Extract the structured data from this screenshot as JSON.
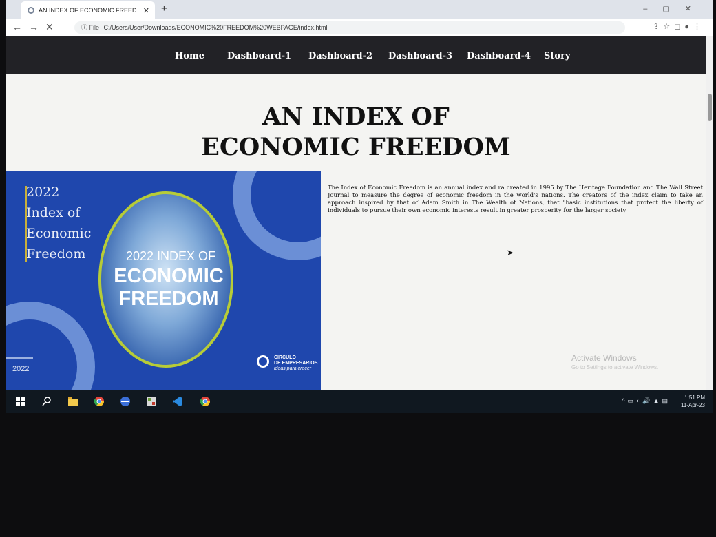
{
  "browser": {
    "tab_title": "AN INDEX OF ECONOMIC FREED",
    "tab_close": "✕",
    "new_tab": "+",
    "back": "←",
    "forward": "→",
    "stop": "✕",
    "file_label": "ⓘ File",
    "url": "C:/Users/User/Downloads/ECONOMIC%20FREEDOM%20WEBPAGE/index.html"
  },
  "nav": {
    "items": [
      "Home",
      "Dashboard-1",
      "Dashboard-2",
      "Dashboard-3",
      "Dashboard-4",
      "Story"
    ]
  },
  "page": {
    "title_line1": "AN INDEX OF",
    "title_line2": "ECONOMIC FREEDOM",
    "description": "The Index of Economic Freedom is an annual index and ra created in 1995 by The Heritage Foundation and The Wall Street Journal to measure the degree of economic freedom in the world's nations. The creators of the index claim to take an approach inspired by that of Adam Smith in The Wealth of Nations, that \"basic institutions that protect the liberty of individuals to pursue their own economic interests result in greater prosperity for the larger society"
  },
  "banner": {
    "year": "2022",
    "line2": "Index of",
    "line3": "Economic",
    "line4": "Freedom",
    "globe_small": "2022 INDEX OF",
    "globe_big1": "ECONOMIC",
    "globe_big2": "FREEDOM",
    "corner_year": "2022",
    "logo_line1": "CIRCULO",
    "logo_line2": "DE EMPRESARIOS",
    "logo_line3": "ideas para crecer"
  },
  "windows": {
    "watermark_title": "Activate Windows",
    "watermark_sub": "Go to Settings to activate Windows.",
    "time": "1:51 PM",
    "date": "11-Apr-23"
  },
  "colors": {
    "nav_bg": "#222226",
    "banner_blue": "#1f47ad",
    "globe_ring": "#b7cc37"
  }
}
